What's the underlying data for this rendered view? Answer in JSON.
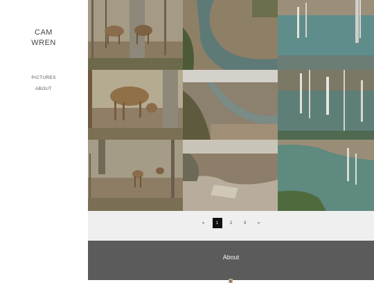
{
  "site": {
    "title_line1": "CAM",
    "title_line2": "WREN"
  },
  "nav": {
    "items": [
      {
        "label": "PICTURES"
      },
      {
        "label": "ABOUT"
      }
    ]
  },
  "gallery": {
    "tiles": [
      {
        "subject": "deer-in-woods"
      },
      {
        "subject": "river-bend"
      },
      {
        "subject": "flooded-trees"
      },
      {
        "subject": "grazing-deer"
      },
      {
        "subject": "canyon-river"
      },
      {
        "subject": "dead-trees-water"
      },
      {
        "subject": "deer-among-trees"
      },
      {
        "subject": "rocky-bluff"
      },
      {
        "subject": "lake-shore"
      }
    ]
  },
  "pagination": {
    "prev": "«",
    "pages": [
      "1",
      "2",
      "3"
    ],
    "current": "1",
    "next": "»"
  },
  "footer": {
    "title": "About"
  },
  "colors": {
    "footer_bg": "#5b5b5b",
    "pager_bg": "#efefef",
    "current_page_bg": "#111111"
  }
}
